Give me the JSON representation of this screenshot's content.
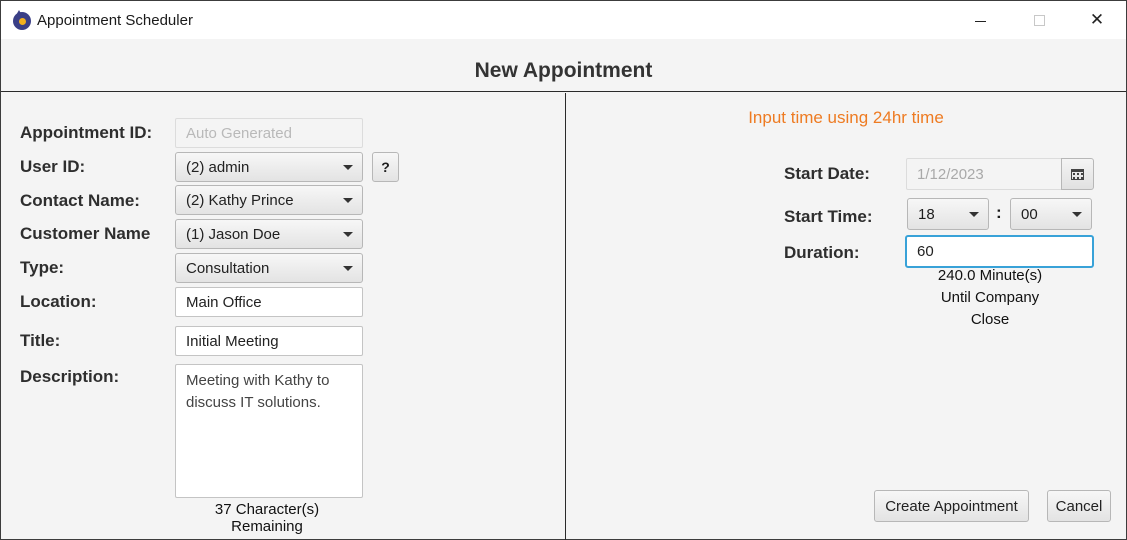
{
  "window": {
    "title": "Appointment Scheduler",
    "app_icon": "appointment-scheduler-logo",
    "controls": {
      "minimize_icon": "minimize-icon",
      "maximize_icon": "maximize-icon",
      "close_icon": "close-icon",
      "close_glyph": "✕"
    }
  },
  "form": {
    "heading": "New Appointment",
    "appointment_id": {
      "label": "Appointment ID:",
      "placeholder": "Auto Generated"
    },
    "user_id": {
      "label": "User ID:",
      "value": "(2) admin",
      "help_label": "?"
    },
    "contact": {
      "label": "Contact Name:",
      "value": "(2) Kathy Prince"
    },
    "customer": {
      "label": "Customer Name",
      "value": "(1) Jason Doe"
    },
    "type": {
      "label": "Type:",
      "value": "Consultation"
    },
    "location": {
      "label": "Location:",
      "value": "Main Office"
    },
    "title": {
      "label": "Title:",
      "value": "Initial Meeting"
    },
    "description": {
      "label": "Description:",
      "value": "Meeting with Kathy to discuss IT solutions.",
      "remaining": "37 Character(s) Remaining"
    }
  },
  "schedule": {
    "hint": "Input time using 24hr time",
    "start_date": {
      "label": "Start Date:",
      "value": "1/12/2023",
      "icon": "calendar-icon"
    },
    "start_time": {
      "label": "Start Time:",
      "hour": "18",
      "separator": ":",
      "minute": "00"
    },
    "duration": {
      "label": "Duration:",
      "value": "60",
      "until_close_line1": "240.0 Minute(s)",
      "until_close_line2": "Until Company",
      "until_close_line3": "Close"
    }
  },
  "actions": {
    "create": "Create Appointment",
    "cancel": "Cancel"
  },
  "colors": {
    "hint": "#ee7b22",
    "focus_border": "#38a2d8",
    "app_icon": "#3a3f86"
  }
}
